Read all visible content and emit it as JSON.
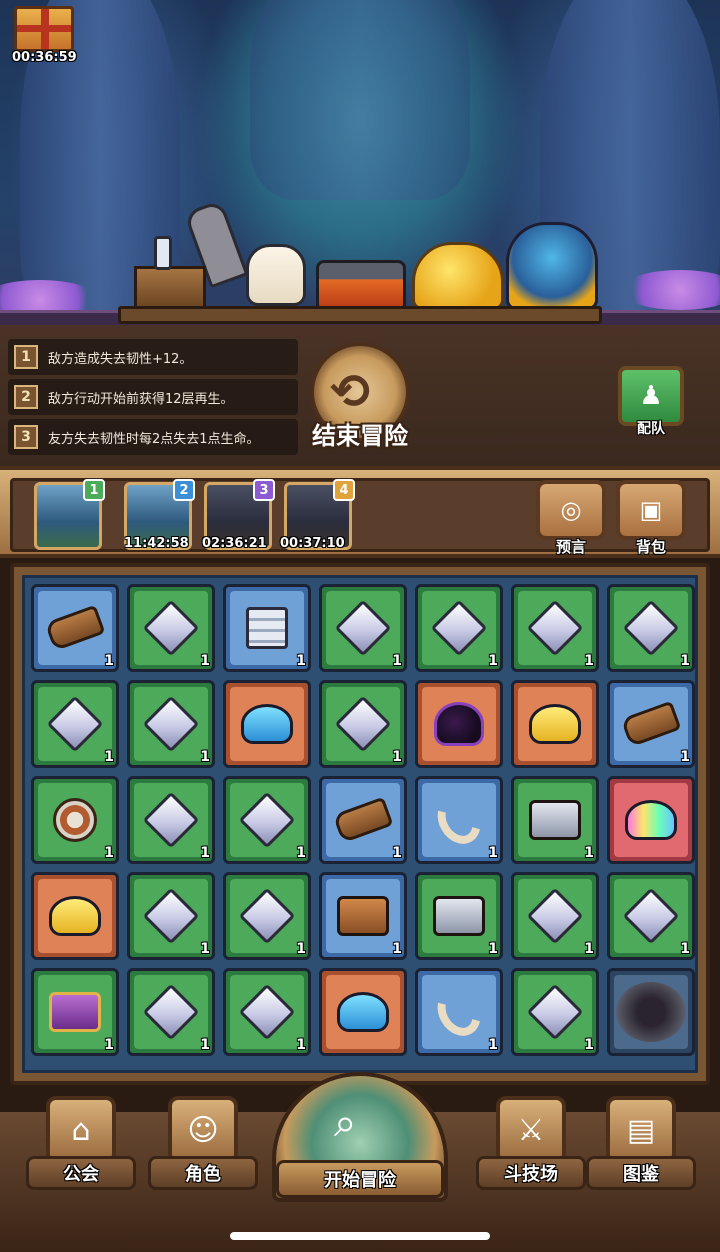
{
  "gift": {
    "timer": "00:36:59",
    "icon": "gift-box-icon"
  },
  "buffs": [
    {
      "index": "1",
      "text": "敌方造成失去韧性+12。"
    },
    {
      "index": "2",
      "text": "敌方行动开始前获得12层再生。"
    },
    {
      "index": "3",
      "text": "友方失去韧性时每2点失去1点生命。"
    }
  ],
  "end_adventure": {
    "label": "结束冒险",
    "icon": "return-arrow-icon"
  },
  "team": {
    "label": "配队",
    "icon": "team-icon"
  },
  "stages": [
    {
      "badge": "1",
      "time": "",
      "badge_color": "#4caa5a",
      "locked": false
    },
    {
      "badge": "2",
      "time": "11:42:58",
      "badge_color": "#3b8fd6",
      "locked": false
    },
    {
      "badge": "3",
      "time": "02:36:21",
      "badge_color": "#8e5ad1",
      "locked": true
    },
    {
      "badge": "4",
      "time": "00:37:10",
      "badge_color": "#e0a23a",
      "locked": true
    }
  ],
  "side_buttons": {
    "prophecy": {
      "label": "预言",
      "icon": "prophecy-icon"
    },
    "bag": {
      "label": "背包",
      "icon": "backpack-icon"
    }
  },
  "grid": {
    "rows": [
      [
        {
          "bg": "blue",
          "item": "log",
          "count": "1"
        },
        {
          "bg": "green",
          "item": "crystal",
          "count": "1"
        },
        {
          "bg": "blue",
          "item": "stack",
          "count": "1"
        },
        {
          "bg": "green",
          "item": "crystal",
          "count": "1"
        },
        {
          "bg": "green",
          "item": "crystal",
          "count": "1"
        },
        {
          "bg": "green",
          "item": "crystal",
          "count": "1"
        },
        {
          "bg": "green",
          "item": "crystal",
          "count": "1"
        }
      ],
      [
        {
          "bg": "green",
          "item": "crystal",
          "count": "1"
        },
        {
          "bg": "green",
          "item": "crystal",
          "count": "1"
        },
        {
          "bg": "orange",
          "item": "slime-blue",
          "count": ""
        },
        {
          "bg": "green",
          "item": "crystal",
          "count": "1"
        },
        {
          "bg": "orange",
          "item": "slime-purple",
          "count": ""
        },
        {
          "bg": "orange",
          "item": "slime-yellow",
          "count": ""
        },
        {
          "bg": "blue",
          "item": "log",
          "count": "1"
        }
      ],
      [
        {
          "bg": "green",
          "item": "shield",
          "count": "1"
        },
        {
          "bg": "green",
          "item": "crystal",
          "count": "1"
        },
        {
          "bg": "green",
          "item": "crystal",
          "count": "1"
        },
        {
          "bg": "blue",
          "item": "log",
          "count": "1"
        },
        {
          "bg": "blue",
          "item": "hook",
          "count": "1"
        },
        {
          "bg": "green",
          "item": "chest-grey",
          "count": "1"
        },
        {
          "bg": "red",
          "item": "slime-rainbow",
          "count": ""
        }
      ],
      [
        {
          "bg": "orange",
          "item": "slime-yellow",
          "count": ""
        },
        {
          "bg": "green",
          "item": "crystal",
          "count": "1"
        },
        {
          "bg": "green",
          "item": "crystal",
          "count": "1"
        },
        {
          "bg": "blue",
          "item": "chest-wood",
          "count": "1"
        },
        {
          "bg": "green",
          "item": "chest-grey",
          "count": "1"
        },
        {
          "bg": "green",
          "item": "crystal",
          "count": "1"
        },
        {
          "bg": "green",
          "item": "crystal",
          "count": "1"
        }
      ],
      [
        {
          "bg": "green",
          "item": "chest-purple",
          "count": "1"
        },
        {
          "bg": "green",
          "item": "crystal",
          "count": "1"
        },
        {
          "bg": "green",
          "item": "crystal",
          "count": "1"
        },
        {
          "bg": "orange",
          "item": "slime-blue",
          "count": ""
        },
        {
          "bg": "blue",
          "item": "hook",
          "count": "1"
        },
        {
          "bg": "green",
          "item": "crystal",
          "count": "1"
        },
        {
          "bg": "dark",
          "item": "pit",
          "count": ""
        }
      ]
    ]
  },
  "nav": {
    "guild": {
      "label": "公会",
      "icon": "guild-house-icon"
    },
    "character": {
      "label": "角色",
      "icon": "character-icon"
    },
    "start": {
      "label": "开始冒险",
      "icon": "magnifier-map-icon"
    },
    "arena": {
      "label": "斗技场",
      "icon": "crossed-swords-icon"
    },
    "codex": {
      "label": "图鉴",
      "icon": "codex-book-icon"
    }
  }
}
